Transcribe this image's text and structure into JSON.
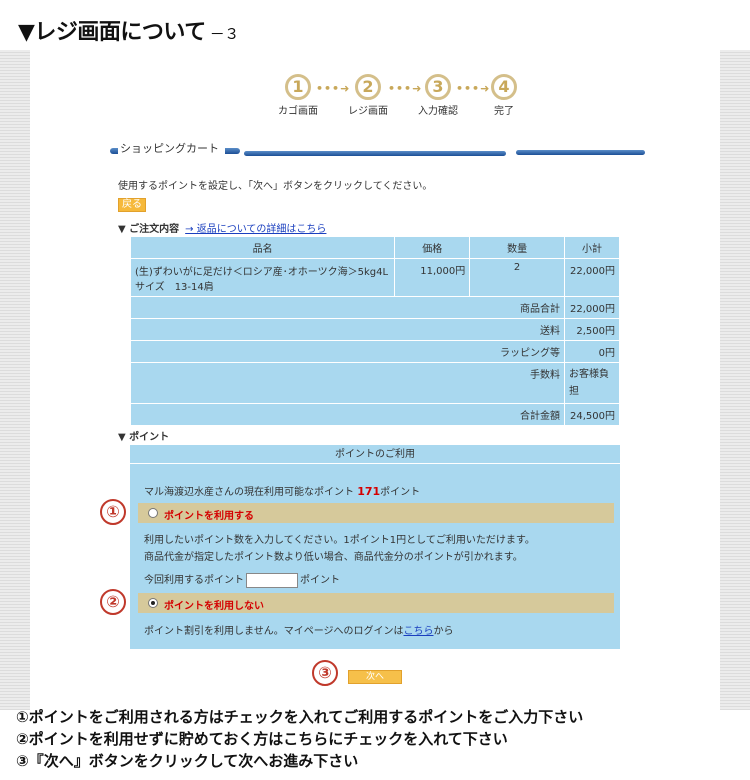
{
  "page_title": "▼レジ画面について",
  "page_title_num": "－３",
  "steps": [
    {
      "num": "1",
      "label": "カゴ画面"
    },
    {
      "num": "2",
      "label": "レジ画面"
    },
    {
      "num": "3",
      "label": "入力確認"
    },
    {
      "num": "4",
      "label": "完了"
    }
  ],
  "step_arrow": "•••➜",
  "cart_title": "ショッピングカート",
  "instruction": "使用するポイントを設定し、「次へ」ボタンをクリックしてください。",
  "back_label": "戻る",
  "order": {
    "heading": "▼ ご注文内容",
    "link": "→ 返品についての詳細はこちら",
    "columns": [
      "品名",
      "価格",
      "数量",
      "小計"
    ],
    "item": {
      "name_line1": "(生)ずわいがに足だけ＜ロシア産･オホーツク海＞5kg4L",
      "name_line2": "サイズ　13-14肩",
      "price": "11,000円",
      "qty": "2",
      "subtotal": "22,000円"
    },
    "summary": [
      {
        "label": "商品合計",
        "value": "22,000円"
      },
      {
        "label": "送料",
        "value": "2,500円"
      },
      {
        "label": "ラッピング等",
        "value": "0円"
      },
      {
        "label": "手数料",
        "value": "お客様負担"
      },
      {
        "label": "合計金額",
        "value": "24,500円"
      }
    ]
  },
  "points": {
    "heading": "▼ ポイント",
    "box_title": "ポイントのご利用",
    "available_prefix": "マル海渡辺水産さんの現在利用可能なポイント",
    "available_value": "171",
    "available_suffix": "ポイント",
    "use_label": "ポイントを利用する",
    "use_desc1": "利用したいポイント数を入力してください。1ポイント1円としてご利用いただけます。",
    "use_desc2": "商品代金が指定したポイント数より低い場合、商品代金分のポイントが引かれます。",
    "input_label": "今回利用するポイント",
    "input_value": "",
    "input_unit": "ポイント",
    "nouse_label": "ポイントを利用しない",
    "nouse_desc_pre": "ポイント割引を利用しません。マイページへのログインは",
    "nouse_link": "こちら",
    "nouse_desc_post": "から",
    "selected": "nouse"
  },
  "markers": [
    "①",
    "②",
    "③"
  ],
  "next_label": "次へ",
  "notes": [
    "①ポイントをご利用される方はチェックを入れてご利用するポイントをご入力下さい",
    "②ポイントを利用せずに貯めておく方はこちらにチェックを入れて下さい",
    "③『次へ』ボタンをクリックして次へお進み下さい"
  ],
  "colors": {
    "accent": "#e05a1a",
    "step": "#c8a85a",
    "table_bg": "#a9d8ef",
    "option_bg": "#d6c99b",
    "red": "#d40000"
  }
}
